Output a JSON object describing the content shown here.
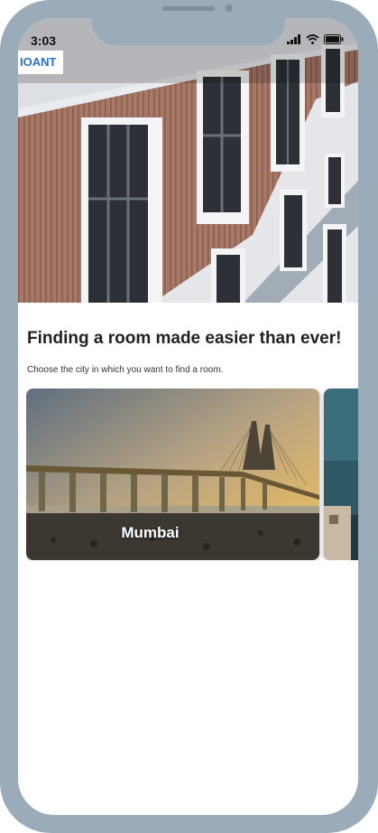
{
  "status_bar": {
    "time": "3:03"
  },
  "brand": {
    "label": "IOANT"
  },
  "main": {
    "title": "Finding a room made easier than ever!",
    "subtitle": "Choose the city in which you want to find a room.",
    "cities": [
      {
        "name": "Mumbai"
      }
    ]
  },
  "colors": {
    "frame": "#9aabb9",
    "brand": "#2b6fd6"
  }
}
